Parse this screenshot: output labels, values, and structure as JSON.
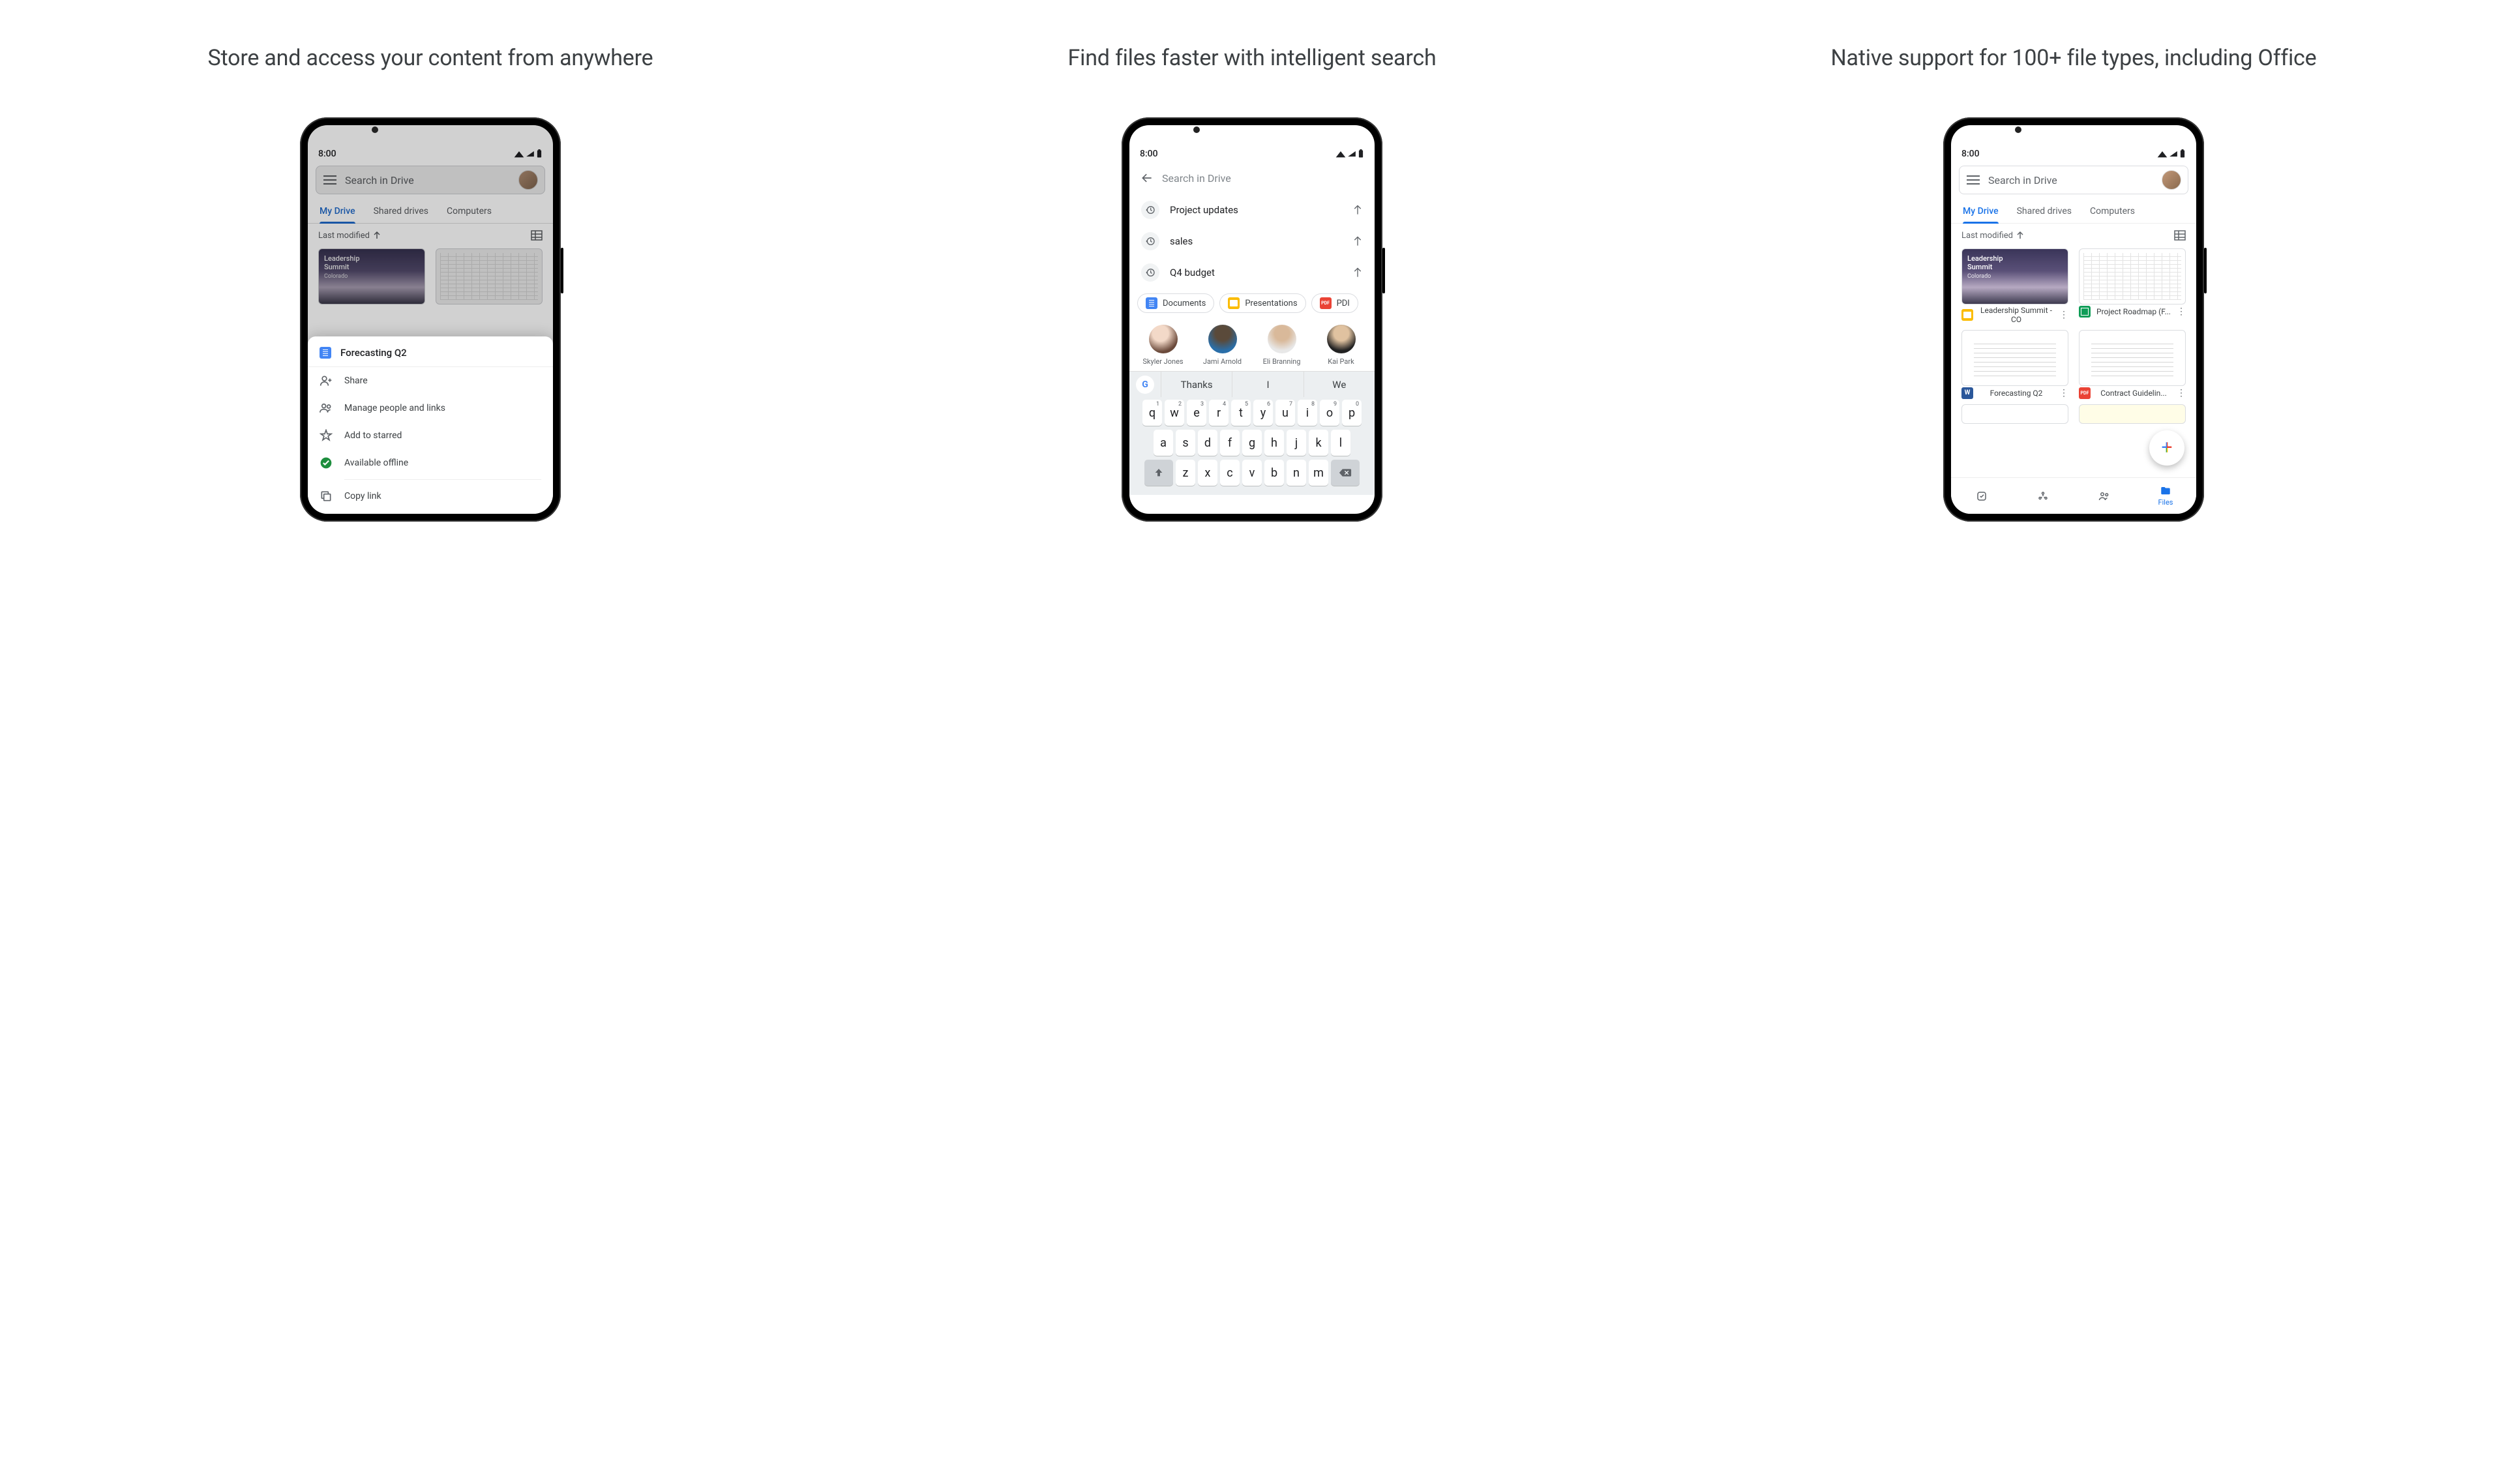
{
  "headlines": {
    "col1": "Store and access your content from anywhere",
    "col2": "Find files faster with intelligent search",
    "col3": "Native support for 100+ file types, including Office"
  },
  "status": {
    "time": "8:00"
  },
  "search": {
    "placeholder": "Search in Drive"
  },
  "tabs": {
    "myDrive": "My Drive",
    "shared": "Shared drives",
    "computers": "Computers"
  },
  "sort": {
    "label": "Last modified"
  },
  "leadership": {
    "line1": "Leadership",
    "line2": "Summit",
    "sub": "Colorado"
  },
  "sheet": {
    "title": "Forecasting Q2",
    "share": "Share",
    "manage": "Manage people and links",
    "star": "Add to starred",
    "offline": "Available offline",
    "copy": "Copy link"
  },
  "suggestions": {
    "s1": "Project updates",
    "s2": "sales",
    "s3": "Q4 budget"
  },
  "chips": {
    "docs": "Documents",
    "pres": "Presentations",
    "pdf": "PDI"
  },
  "people": {
    "p1": "Skyler Jones",
    "p2": "Jami Arnold",
    "p3": "Eli Branning",
    "p4": "Kai Park"
  },
  "ime": {
    "s1": "Thanks",
    "s2": "I",
    "s3": "We"
  },
  "files": {
    "f1": "Leadership Summit - CO",
    "f2": "Project Roadmap (F...",
    "f3": "Forecasting Q2",
    "f4": "Contract Guidelin..."
  },
  "nav": {
    "files": "Files"
  },
  "kbd": {
    "row1": [
      [
        "q",
        "1"
      ],
      [
        "w",
        "2"
      ],
      [
        "e",
        "3"
      ],
      [
        "r",
        "4"
      ],
      [
        "t",
        "5"
      ],
      [
        "y",
        "6"
      ],
      [
        "u",
        "7"
      ],
      [
        "i",
        "8"
      ],
      [
        "o",
        "9"
      ],
      [
        "p",
        "0"
      ]
    ],
    "row2": [
      "a",
      "s",
      "d",
      "f",
      "g",
      "h",
      "j",
      "k",
      "l"
    ],
    "row3": [
      "z",
      "x",
      "c",
      "v",
      "b",
      "n",
      "m"
    ]
  }
}
